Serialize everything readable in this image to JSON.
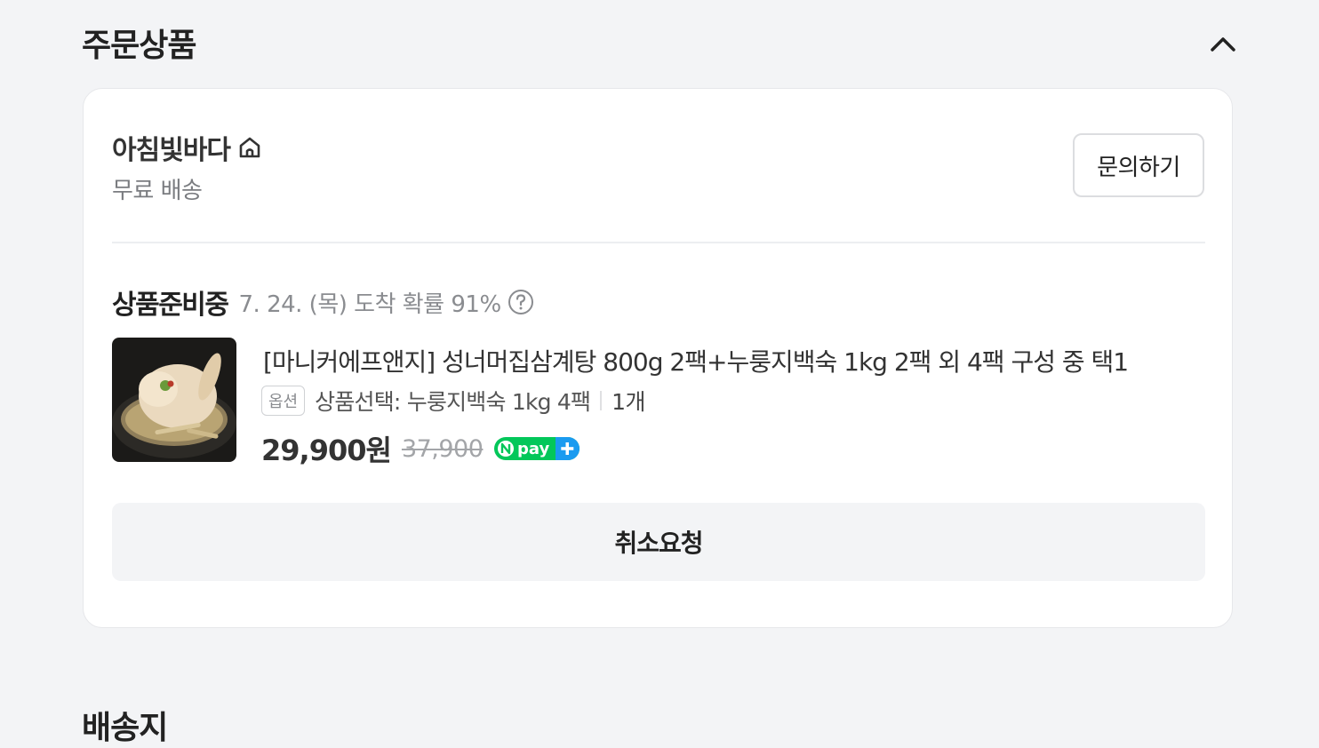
{
  "order_section": {
    "title": "주문상품",
    "collapse_icon": "chevron-up-icon"
  },
  "store": {
    "name": "아침빛바다",
    "icon": "home-icon",
    "shipping": "무료 배송",
    "inquiry_button": "문의하기"
  },
  "order": {
    "status": "상품준비중",
    "eta": "7. 24. (목) 도착 확률 91%",
    "eta_icon": "question-circle-icon"
  },
  "product": {
    "image_alt": "삼계탕",
    "title": "[마니커에프앤지] 성너머집삼계탕 800g 2팩+누룽지백숙 1kg 2팩 외 4팩 구성 중 택1",
    "option_badge": "옵션",
    "option_text": "상품선택: 누룽지백숙 1kg 4팩",
    "quantity": "1개",
    "price": "29,900원",
    "original_price": "37,900",
    "payment_badge": "npay+"
  },
  "actions": {
    "cancel_button": "취소요청"
  },
  "shipping_section": {
    "title": "배송지"
  },
  "colors": {
    "background": "#f3f4f6",
    "card": "#ffffff",
    "npay_green": "#03c75a",
    "npay_blue": "#1a9bf0"
  }
}
